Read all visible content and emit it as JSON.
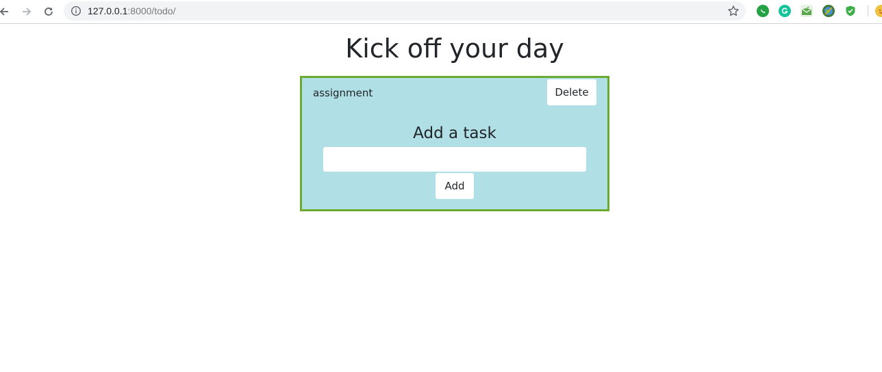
{
  "browser": {
    "url_host": "127.0.0.1",
    "url_path": ":8000/todo/",
    "icons": {
      "back": "back-arrow-icon",
      "forward": "forward-arrow-icon",
      "reload": "reload-icon",
      "info": "info-icon",
      "bookmark": "bookmark-star-icon"
    },
    "extensions": [
      {
        "name": "whatsapp-extension-icon",
        "color": "#25a244"
      },
      {
        "name": "grammarly-extension-icon",
        "color": "#15c39a"
      },
      {
        "name": "mail-extension-icon",
        "color": "#5aa84a"
      },
      {
        "name": "globe-extension-icon",
        "color": "#3d7a3a"
      },
      {
        "name": "shield-extension-icon",
        "color": "#3fae49"
      },
      {
        "name": "avatar-extension-icon",
        "color": "#f0c040"
      }
    ]
  },
  "page": {
    "title": "Kick off your day"
  },
  "todo": {
    "tasks": [
      {
        "name": "assignment",
        "delete_label": "Delete"
      }
    ],
    "add_heading": "Add a task",
    "input_value": "",
    "add_label": "Add"
  },
  "colors": {
    "card_background": "#b0dfe5",
    "card_border": "#6aaa2e"
  }
}
